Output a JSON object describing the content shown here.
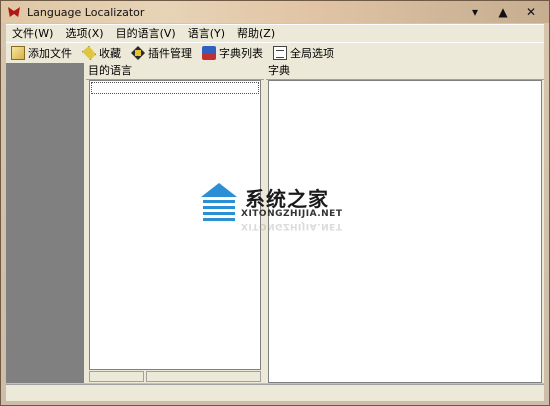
{
  "window": {
    "title": "Language Localizator"
  },
  "window_buttons": {
    "minimize": "▾",
    "maximize": "▲",
    "close": "✕"
  },
  "menu": [
    {
      "label": "文件(W)"
    },
    {
      "label": "选项(X)"
    },
    {
      "label": "目的语言(V)"
    },
    {
      "label": "语言(Y)"
    },
    {
      "label": "帮助(Z)"
    }
  ],
  "toolbar": [
    {
      "label": "添加文件",
      "icon": "add-file-icon"
    },
    {
      "label": "收藏",
      "icon": "favorites-icon"
    },
    {
      "label": "插件管理",
      "icon": "plugin-icon"
    },
    {
      "label": "字典列表",
      "icon": "dictionary-icon"
    },
    {
      "label": "全局选项",
      "icon": "options-icon"
    }
  ],
  "panes": {
    "target_language_header": "目的语言",
    "dictionary_header": "字典"
  },
  "watermark": {
    "title": "系统之家",
    "subtitle": "XITONGZHIJIA.NET"
  },
  "colors": {
    "accent": "#2b8fd6",
    "panel": "#ece9d8",
    "sidebar": "#808080"
  }
}
